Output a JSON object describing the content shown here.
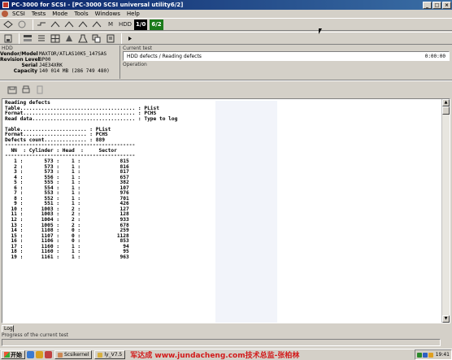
{
  "window": {
    "title": "PC-3000 for SCSI - [PC-3000 SCSI universal utility6/2]",
    "controls": [
      "_",
      "□",
      "×"
    ]
  },
  "menu": [
    "SCSI",
    "Tests",
    "Mode",
    "Tools",
    "Windows",
    "Help"
  ],
  "toolbar1": {
    "labels": [
      "M",
      "HDD",
      "1/0",
      "6/2"
    ]
  },
  "hdd": {
    "section_label": "HDD",
    "rows": [
      {
        "key": "Vendor/Model",
        "value": "MAXTOR/ATLAS10K5_147SAS"
      },
      {
        "key": "Revision Level",
        "value": "BP00"
      },
      {
        "key": "Serial",
        "value": "J4E34XRK"
      },
      {
        "key": "Capacity",
        "value": "140 014 MB (286 749 480)"
      }
    ]
  },
  "current_test": {
    "label": "Current test",
    "name": "HDD defects / Reading defects",
    "time": "0:00:00",
    "operation_label": "Operation"
  },
  "log": {
    "title": "Reading defects",
    "settings": [
      {
        "key": "Table",
        "value": "PList"
      },
      {
        "key": "Format",
        "value": "PCHS"
      },
      {
        "key": "Read data",
        "value": "Type to log"
      }
    ],
    "summary": [
      {
        "key": "Table",
        "value": "PList"
      },
      {
        "key": "Format",
        "value": "PCHS"
      },
      {
        "key": "Defects count",
        "value": "889"
      }
    ],
    "headers": [
      "NN",
      "Cylinder",
      "Head",
      "Sector"
    ],
    "rows": [
      [
        1,
        573,
        1,
        815
      ],
      [
        2,
        573,
        1,
        816
      ],
      [
        3,
        573,
        1,
        817
      ],
      [
        4,
        556,
        1,
        657
      ],
      [
        5,
        555,
        1,
        382
      ],
      [
        6,
        554,
        1,
        107
      ],
      [
        7,
        553,
        1,
        976
      ],
      [
        8,
        552,
        1,
        701
      ],
      [
        9,
        551,
        1,
        426
      ],
      [
        10,
        1003,
        2,
        127
      ],
      [
        11,
        1003,
        2,
        128
      ],
      [
        12,
        1004,
        2,
        933
      ],
      [
        13,
        1005,
        2,
        678
      ],
      [
        14,
        1108,
        0,
        259
      ],
      [
        15,
        1107,
        0,
        1128
      ],
      [
        16,
        1106,
        0,
        853
      ],
      [
        17,
        1160,
        1,
        94
      ],
      [
        18,
        1160,
        1,
        95
      ],
      [
        19,
        1161,
        1,
        963
      ]
    ]
  },
  "tabs": {
    "log": "Log"
  },
  "progress": {
    "label": "Progress of the current test",
    "percent": 0
  },
  "taskbar": {
    "start": "开始",
    "tasks": [
      "Scsikernel",
      "ly_V7.5"
    ],
    "watermark": "军达成 www.jundacheng.com技术总监-张柏林",
    "clock": "19:41"
  }
}
